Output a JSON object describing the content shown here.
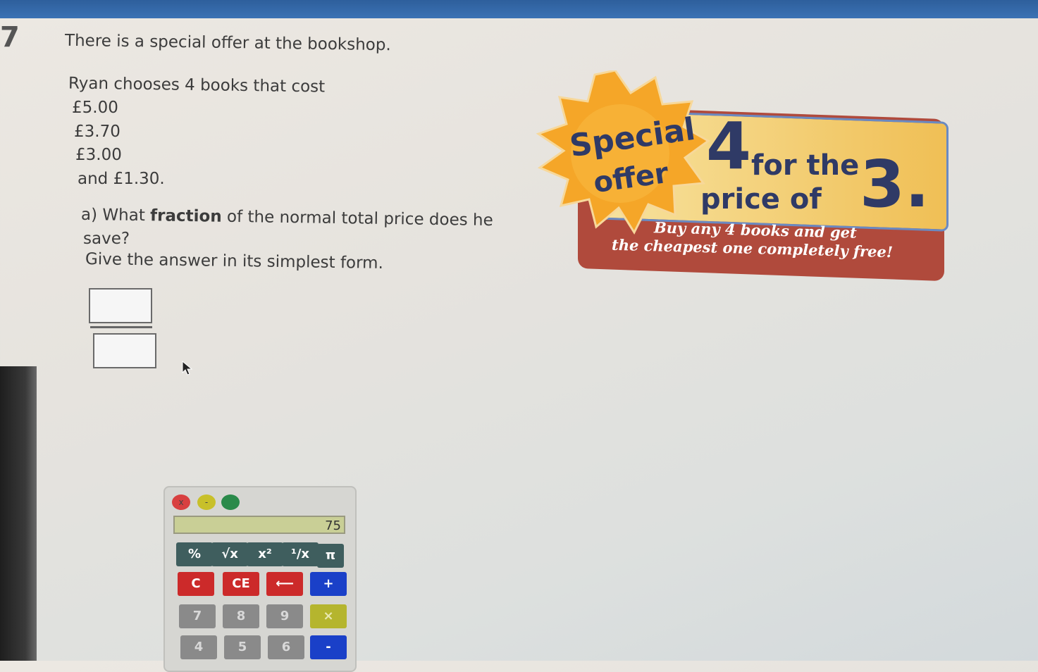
{
  "question": {
    "number": "7",
    "intro": "There is a special offer at the bookshop.",
    "line1": "Ryan chooses 4 books that cost",
    "prices": [
      "£5.00",
      "£3.70",
      "£3.00",
      "and £1.30."
    ],
    "part_a_prefix": "a) What ",
    "part_a_bold": "fraction",
    "part_a_suffix": " of the normal total price does he",
    "part_a_line2": "save?",
    "instruction": "Give the answer in its simplest form."
  },
  "offer": {
    "star_line1": "Special",
    "star_line2": "offer",
    "big_number": "4",
    "for_the": "for the",
    "price_of": "price of",
    "three": "3.",
    "sub1": "Buy any 4 books and get",
    "sub2": "the cheapest one completely free!"
  },
  "calculator": {
    "close_label": "x",
    "min_label": "-",
    "display": "75",
    "row1": [
      "%",
      "√x",
      "x²",
      "¹/x",
      "π"
    ],
    "row2": [
      "C",
      "CE",
      "⟵",
      "+"
    ],
    "row3": [
      "7",
      "8",
      "9",
      "×"
    ],
    "row4": [
      "4",
      "5",
      "6",
      "-"
    ]
  },
  "colors": {
    "star": "#f5a628",
    "banner": "#b04a3c",
    "text_navy": "#2f3a66"
  }
}
